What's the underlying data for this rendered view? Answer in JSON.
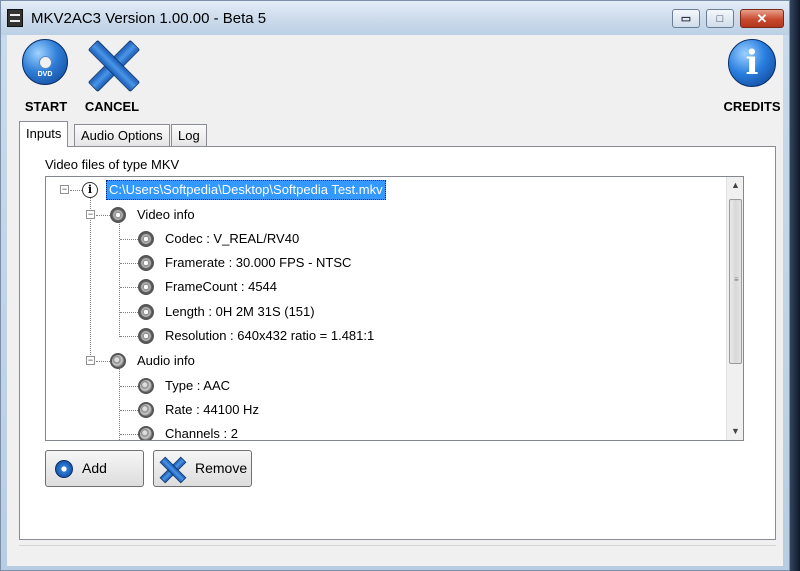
{
  "window": {
    "title": "MKV2AC3 Version 1.00.00 - Beta 5",
    "controls": {
      "minimize": "▭",
      "maximize": "□",
      "close": "✕"
    }
  },
  "toolbar": {
    "start_label": "START",
    "start_disc_text": "DVD",
    "cancel_label": "CANCEL",
    "credits_label": "CREDITS",
    "credits_glyph": "i"
  },
  "tabs": [
    {
      "label": "Inputs",
      "active": true
    },
    {
      "label": "Audio Options",
      "active": false
    },
    {
      "label": "Log",
      "active": false
    }
  ],
  "inputs": {
    "group_label": "Video files of type MKV",
    "tree": {
      "root": {
        "text": "C:\\Users\\Softpedia\\Desktop\\Softpedia Test.mkv",
        "icon": "info-icon",
        "selected": true
      },
      "video_info": {
        "label": "Video info",
        "items": [
          "Codec : V_REAL/RV40",
          "Framerate : 30.000 FPS - NTSC",
          "FrameCount : 4544",
          "Length : 0H 2M 31S (151)",
          "Resolution : 640x432  ratio = 1.481:1"
        ]
      },
      "audio_info": {
        "label": "Audio info",
        "items": [
          "Type : AAC",
          "Rate : 44100 Hz",
          "Channels : 2"
        ]
      }
    },
    "buttons": {
      "add": "Add",
      "remove": "Remove"
    }
  },
  "tree_glyphs": {
    "minus": "−",
    "info": "i"
  },
  "scroll_glyphs": {
    "up": "▲",
    "down": "▼"
  }
}
